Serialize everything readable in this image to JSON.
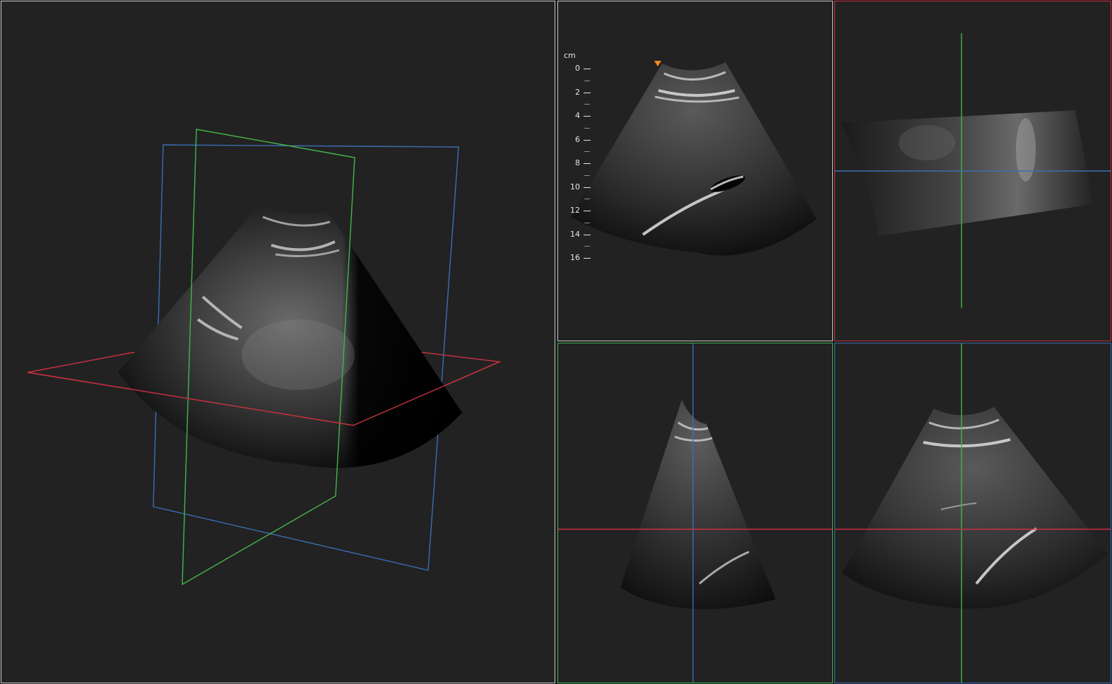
{
  "depth_scale": {
    "unit": "cm",
    "ticks": [
      "0",
      "2",
      "4",
      "6",
      "8",
      "10",
      "12",
      "14",
      "16"
    ]
  },
  "colors": {
    "axial_plane": "#c8313f",
    "sagittal_plane": "#44b54a",
    "coronal_plane": "#3a6fb5",
    "acquisition_border": "#c9c9c9",
    "orientation_marker": "#f08a1c",
    "background": "#222222"
  },
  "views": [
    {
      "id": "3d",
      "icon": "volume-3d-icon"
    },
    {
      "id": "acquisition",
      "icon": "ultrasound-sector-icon"
    },
    {
      "id": "axial",
      "icon": "axial-plane-icon"
    },
    {
      "id": "sagittal",
      "icon": "sagittal-plane-icon"
    },
    {
      "id": "coronal",
      "icon": "coronal-plane-icon"
    }
  ]
}
